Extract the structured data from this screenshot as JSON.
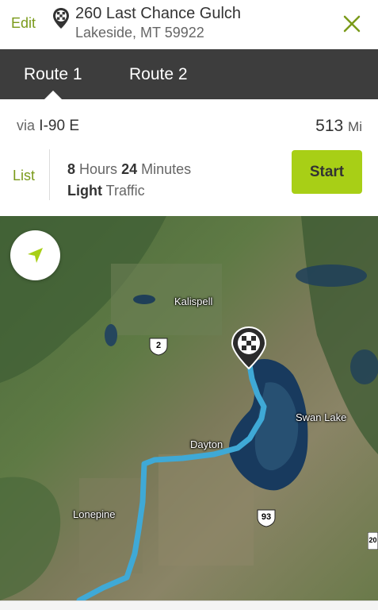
{
  "header": {
    "edit_label": "Edit",
    "address_line1": "260 Last Chance Gulch",
    "address_line2": "Lakeside, MT 59922",
    "dest_icon": "checkered-flag-pin-icon",
    "close_icon": "close-icon"
  },
  "tabs": [
    {
      "label": "Route 1",
      "selected": true
    },
    {
      "label": "Route 2",
      "selected": false
    }
  ],
  "route": {
    "via_prefix": "via",
    "via_road": "I-90 E",
    "distance_value": "513",
    "distance_unit": "Mi",
    "list_label": "List",
    "hours_value": "8",
    "hours_unit": "Hours",
    "minutes_value": "24",
    "minutes_unit": "Minutes",
    "traffic_level": "Light",
    "traffic_word": "Traffic",
    "start_label": "Start"
  },
  "map": {
    "locate_icon": "navigation-arrow-icon",
    "labels": {
      "kalispell": "Kalispell",
      "swan_lake": "Swan Lake",
      "dayton": "Dayton",
      "lonepine": "Lonepine"
    },
    "shields": {
      "us2": "2",
      "us93": "93",
      "edge": "20"
    }
  },
  "colors": {
    "accent": "#a8cf16",
    "accent_text": "#7a9a1a",
    "tab_bar": "#3d3d3d",
    "route_line": "#3fa9d6"
  }
}
